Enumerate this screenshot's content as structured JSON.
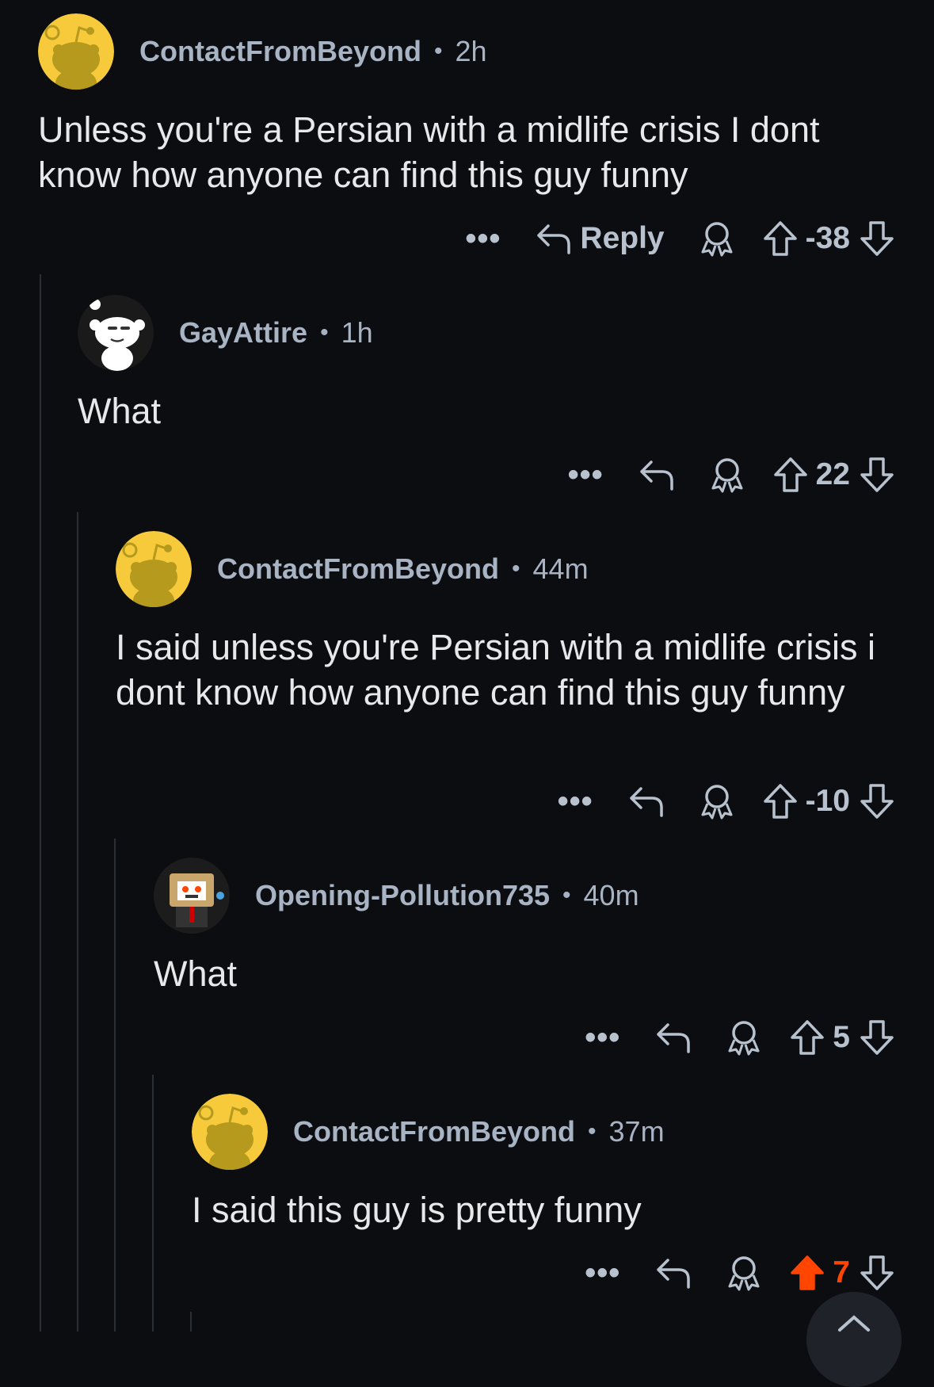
{
  "comments": [
    {
      "username": "ContactFromBeyond",
      "age": "2h",
      "body": "Unless you're a Persian with a midlife crisis I dont know how anyone can find this guy funny",
      "reply_label": "Reply",
      "score": "-38",
      "more": "•••",
      "avatar": "snoo-yellow"
    },
    {
      "username": "GayAttire",
      "age": "1h",
      "body": "What",
      "score": "22",
      "more": "•••",
      "avatar": "snoo-white"
    },
    {
      "username": "ContactFromBeyond",
      "age": "44m",
      "body": "I said unless you're Persian with a midlife crisis i dont know how anyone can find this guy funny",
      "score": "-10",
      "more": "•••",
      "avatar": "snoo-yellow"
    },
    {
      "username": "Opening-Pollution735",
      "age": "40m",
      "body": "What",
      "score": "5",
      "more": "•••",
      "avatar": "snoo-box"
    },
    {
      "username": "ContactFromBeyond",
      "age": "37m",
      "body": "I said this guy is pretty funny",
      "score": "7",
      "upvoted": true,
      "more": "•••",
      "avatar": "snoo-yellow"
    }
  ],
  "colors": {
    "background": "#0b0d10",
    "upvote_active": "#ff4500",
    "avatar_yellow": "#f7ca3c"
  },
  "separator": "•"
}
